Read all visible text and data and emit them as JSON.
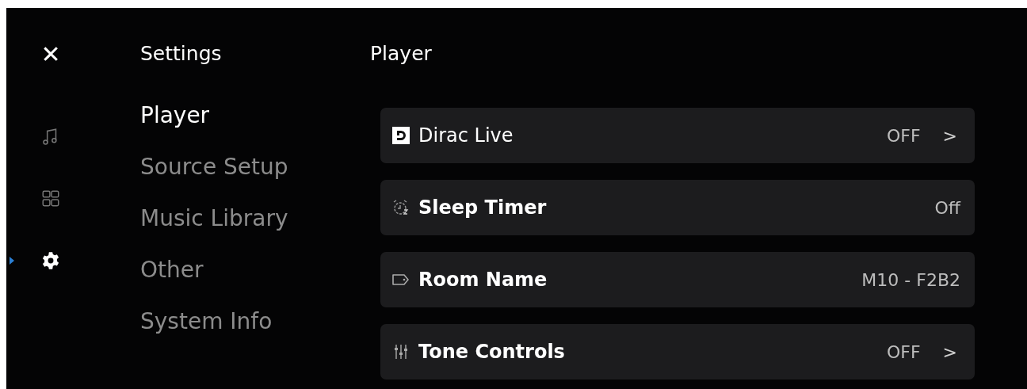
{
  "close_label": "✕",
  "rail": [
    {
      "kind": "music",
      "selected": false
    },
    {
      "kind": "grid",
      "selected": false
    },
    {
      "kind": "gear",
      "selected": true
    }
  ],
  "sidebar": {
    "title": "Settings",
    "items": [
      {
        "label": "Player",
        "selected": true
      },
      {
        "label": "Source Setup",
        "selected": false
      },
      {
        "label": "Music Library",
        "selected": false
      },
      {
        "label": "Other",
        "selected": false
      },
      {
        "label": "System Info",
        "selected": false
      }
    ]
  },
  "page": {
    "title": "Player",
    "rows": [
      {
        "kind": "dirac",
        "label": "Dirac Live",
        "value": "OFF",
        "chevron": ">"
      },
      {
        "kind": "timer",
        "label": "Sleep Timer",
        "value": "Off"
      },
      {
        "kind": "tag",
        "label": "Room Name",
        "value": "M10 - F2B2"
      },
      {
        "kind": "tone",
        "label": "Tone Controls",
        "value": "OFF",
        "chevron": ">"
      }
    ]
  }
}
